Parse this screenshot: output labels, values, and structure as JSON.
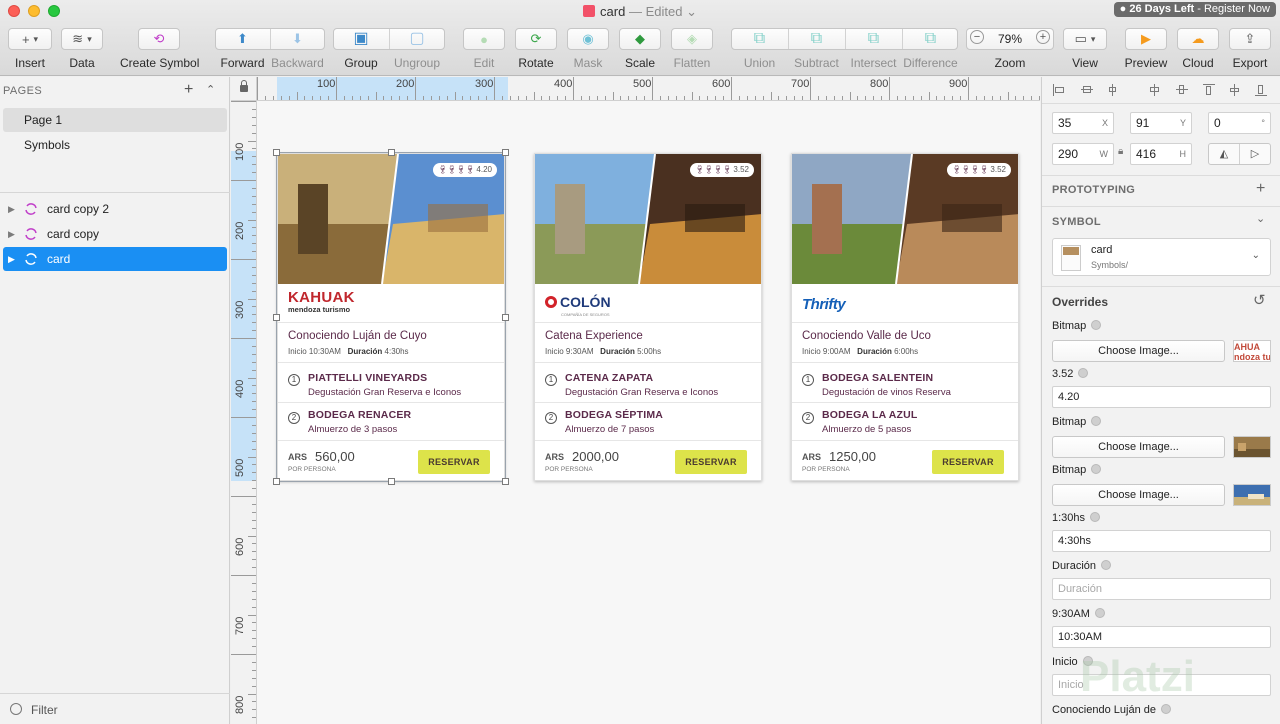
{
  "window": {
    "title": "card",
    "status": "— Edited",
    "trial_days": "26 Days Left",
    "trial_action": "- Register Now"
  },
  "toolbar": {
    "insert": "Insert",
    "data": "Data",
    "create_symbol": "Create Symbol",
    "forward": "Forward",
    "backward": "Backward",
    "group": "Group",
    "ungroup": "Ungroup",
    "edit": "Edit",
    "rotate": "Rotate",
    "mask": "Mask",
    "scale": "Scale",
    "flatten": "Flatten",
    "union": "Union",
    "subtract": "Subtract",
    "intersect": "Intersect",
    "difference": "Difference",
    "zoom": "Zoom",
    "zoom_value": "79%",
    "view": "View",
    "preview": "Preview",
    "cloud": "Cloud",
    "export": "Export"
  },
  "sidebar": {
    "pages_heading": "PAGES",
    "pages": [
      "Page 1",
      "Symbols"
    ],
    "selected_page": "Page 1",
    "layers": [
      "card copy 2",
      "card copy",
      "card"
    ],
    "selected_layer": "card",
    "filter_label": "Filter"
  },
  "ruler": {
    "top_ticks": [
      "100",
      "200",
      "300",
      "400",
      "500",
      "600",
      "700",
      "800",
      "900"
    ],
    "left_ticks": [
      "100",
      "200",
      "300",
      "400",
      "500",
      "600",
      "700",
      "800"
    ]
  },
  "cards": [
    {
      "rating": "4.20",
      "brand": "KAHUAK",
      "brand_sub": "mendoza turismo",
      "tour": "Conociendo Luján de Cuyo",
      "start_label": "Inicio",
      "start": "10:30AM",
      "duration_label": "Duración",
      "duration": "4:30hs",
      "stops": [
        {
          "n": "1",
          "name": "PIATTELLI VINEYARDS",
          "desc": "Degustación Gran Reserva e Iconos"
        },
        {
          "n": "2",
          "name": "BODEGA RENACER",
          "desc": "Almuerzo de 3 pasos"
        }
      ],
      "currency": "ARS",
      "price": "560,00",
      "per_person": "POR PERSONA",
      "cta": "RESERVAR"
    },
    {
      "rating": "3.52",
      "brand": "COLÓN",
      "brand_sub": "COMPAÑÍA DE SEGUROS",
      "tour": "Catena Experience",
      "start_label": "Inicio",
      "start": "9:30AM",
      "duration_label": "Duración",
      "duration": "5:00hs",
      "stops": [
        {
          "n": "1",
          "name": "CATENA ZAPATA",
          "desc": "Degustación Gran Reserva e Iconos"
        },
        {
          "n": "2",
          "name": "BODEGA SÉPTIMA",
          "desc": "Almuerzo de 7 pasos"
        }
      ],
      "currency": "ARS",
      "price": "2000,00",
      "per_person": "POR PERSONA",
      "cta": "RESERVAR"
    },
    {
      "rating": "3.52",
      "brand": "Thrifty",
      "brand_sub": "",
      "tour": "Conociendo Valle de Uco",
      "start_label": "Inicio",
      "start": "9:00AM",
      "duration_label": "Duración",
      "duration": "6:00hs",
      "stops": [
        {
          "n": "1",
          "name": "BODEGA SALENTEIN",
          "desc": "Degustación de vinos Reserva"
        },
        {
          "n": "2",
          "name": "BODEGA LA AZUL",
          "desc": "Almuerzo de 5 pasos"
        }
      ],
      "currency": "ARS",
      "price": "1250,00",
      "per_person": "POR PERSONA",
      "cta": "RESERVAR"
    }
  ],
  "inspector": {
    "x": "35",
    "x_unit": "X",
    "y": "91",
    "y_unit": "Y",
    "rotation": "0",
    "rotation_unit": "°",
    "width": "290",
    "width_unit": "W",
    "height": "416",
    "height_unit": "H",
    "prototyping": "PROTOTYPING",
    "symbol_heading": "SYMBOL",
    "symbol_name": "card",
    "symbol_path": "Symbols/",
    "overrides_heading": "Overrides",
    "choose_image": "Choose Image...",
    "overrides": {
      "bitmap_1": "Bitmap",
      "thumb_text": "AHUA\nndoza turis",
      "rating_label": "3.52",
      "rating_value": "4.20",
      "bitmap_2": "Bitmap",
      "bitmap_3": "Bitmap",
      "duration_label": "1:30hs",
      "duration_value": "4:30hs",
      "dur_label": "Duración",
      "dur_placeholder": "Duración",
      "time_label": "9:30AM",
      "time_value": "10:30AM",
      "inicio_label": "Inicio",
      "inicio_placeholder": "Inicio",
      "tour_label": "Conociendo Luján de"
    }
  },
  "watermark": "Platzi"
}
